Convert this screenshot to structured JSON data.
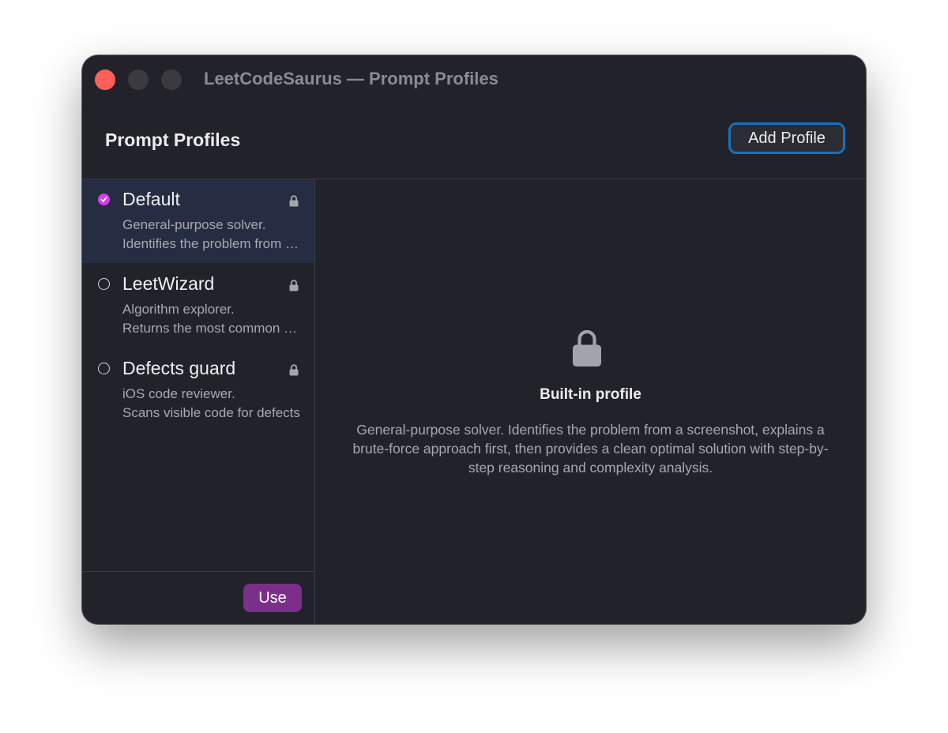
{
  "window": {
    "title": "LeetCodeSaurus — Prompt Profiles"
  },
  "header": {
    "title": "Prompt Profiles",
    "add_profile_label": "Add Profile"
  },
  "sidebar": {
    "items": [
      {
        "name": "Default",
        "desc_line1": "General-purpose solver.",
        "desc_line2": "Identifies the problem from a screenshot, explains a brute-force approach first, then provides a clean optimal solution with step-by-step reasoning and complexity analysis.",
        "selected": true,
        "locked": true
      },
      {
        "name": "LeetWizard",
        "desc_line1": "Algorithm explorer.",
        "desc_line2": "Returns the most common approaches",
        "selected": false,
        "locked": true
      },
      {
        "name": "Defects guard",
        "desc_line1": "iOS code reviewer.",
        "desc_line2": "Scans visible code for defects",
        "selected": false,
        "locked": true
      }
    ],
    "use_label": "Use"
  },
  "detail": {
    "title": "Built-in profile",
    "description": "General-purpose solver. Identifies the problem from a screenshot, explains a brute-force approach first, then provides a clean optimal solution with step-by-step reasoning and complexity analysis.",
    "icon": "lock-icon"
  },
  "colors": {
    "window_bg": "#22222b",
    "selected_bg": "#262d42",
    "radio_checked": "#d63de8",
    "use_button": "#7b2f8a",
    "focus_ring": "#1c6fb9",
    "close_button": "#fe5f57"
  }
}
